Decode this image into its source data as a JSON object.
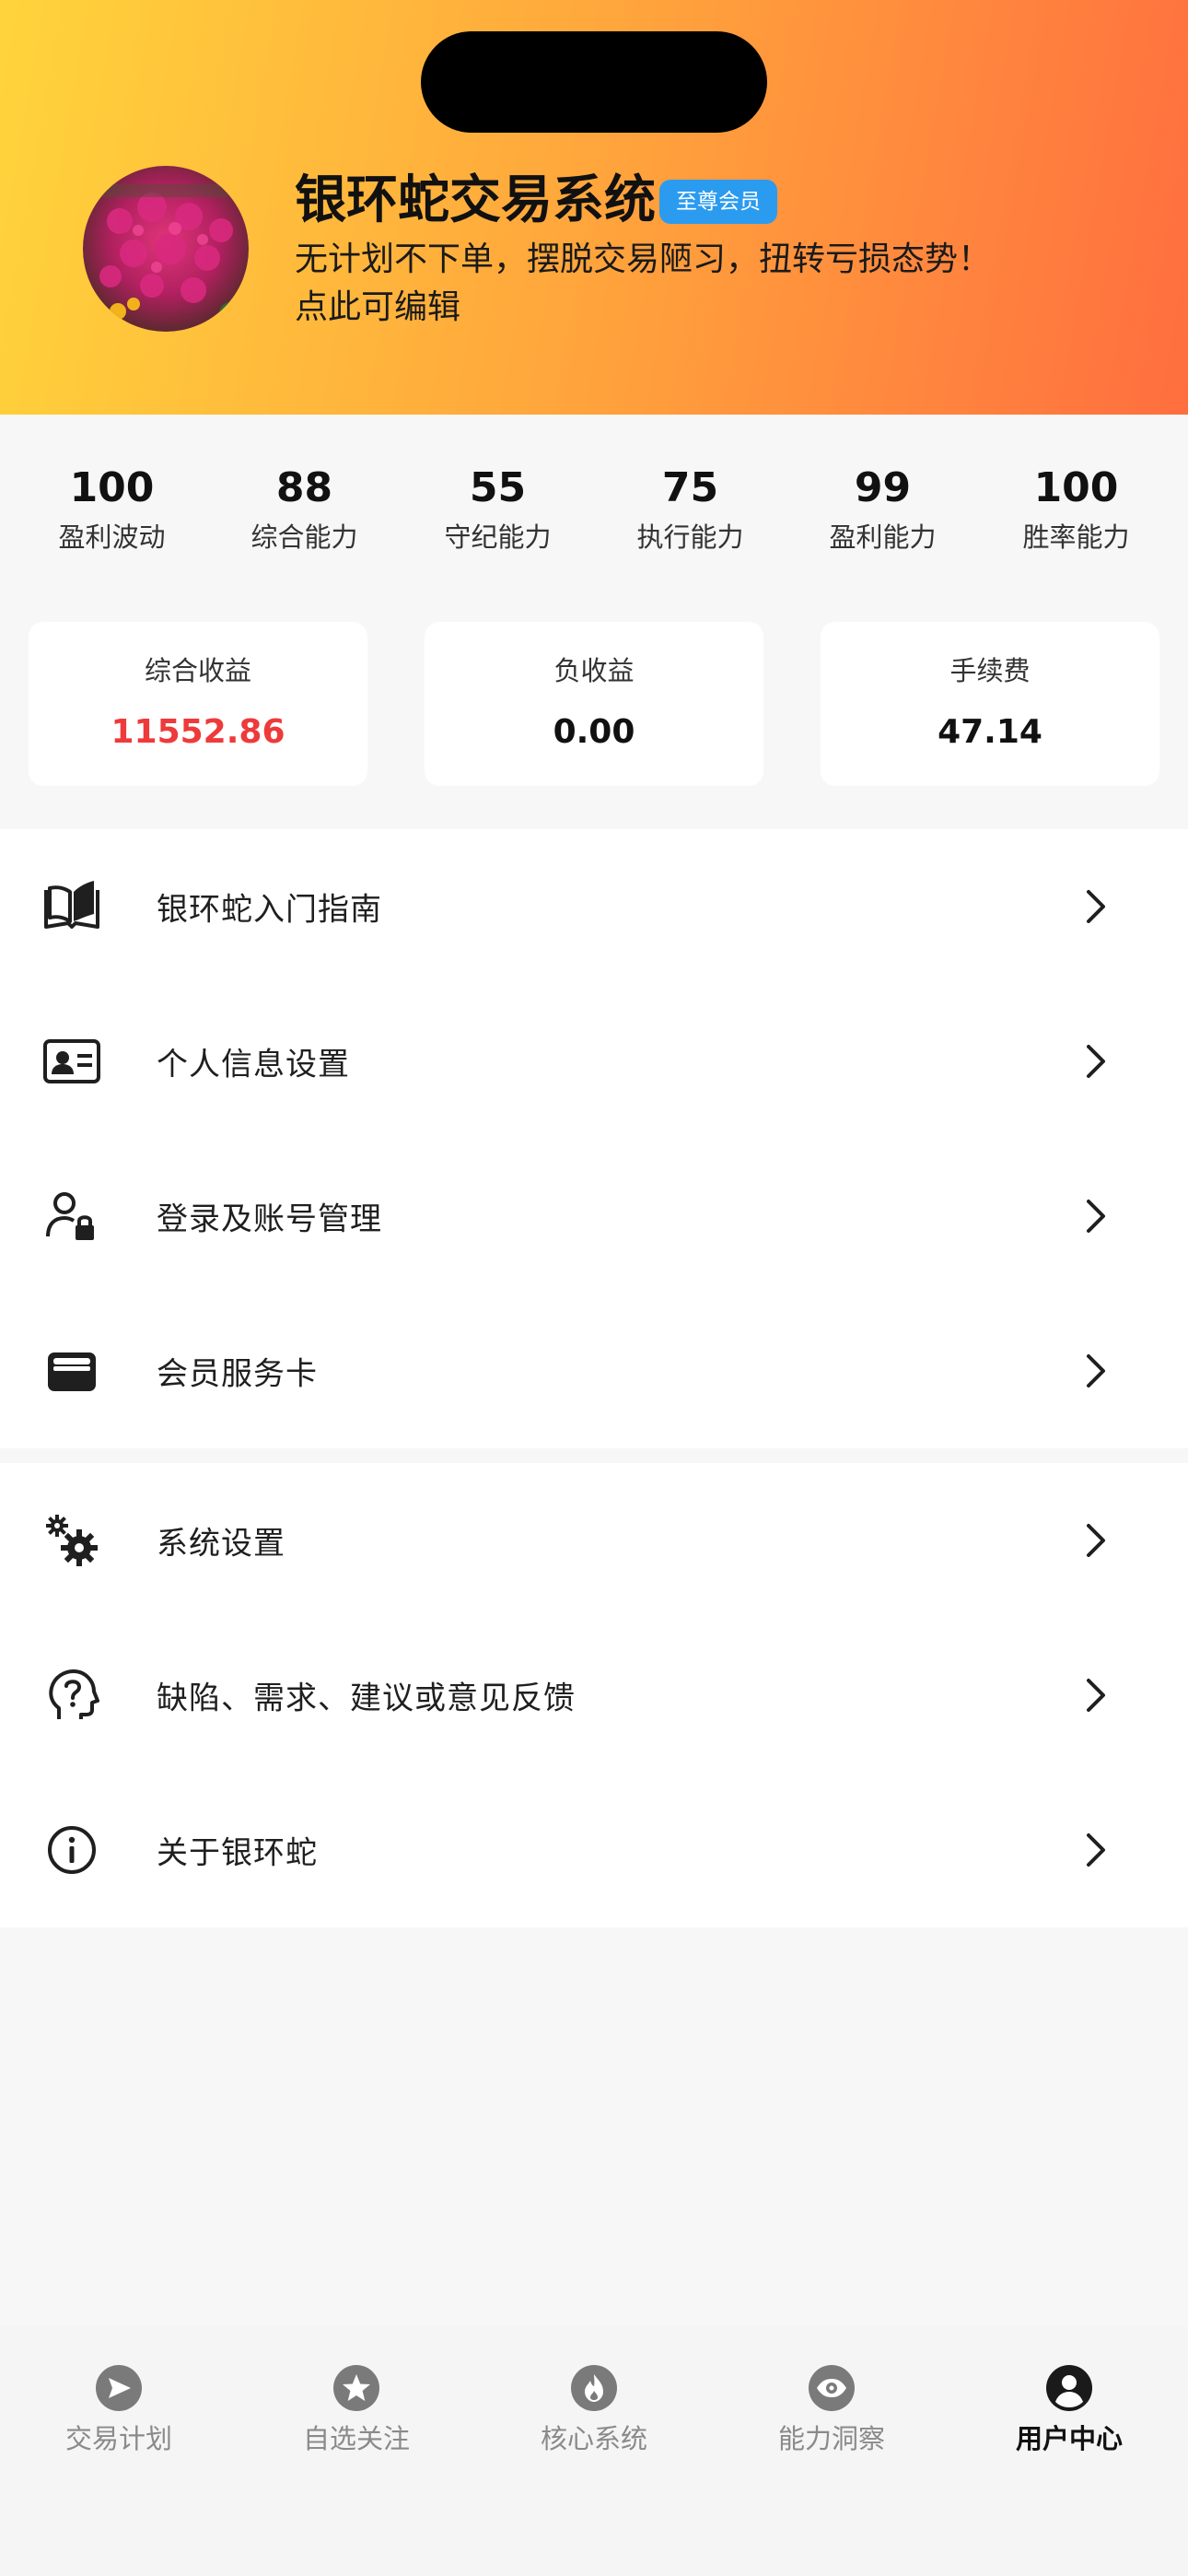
{
  "header": {
    "app_title": "银环蛇交易系统",
    "badge": "至尊会员",
    "motto_line1": "无计划不下单，摆脱交易陋习，扭转亏损态势！",
    "motto_line2": "点此可编辑"
  },
  "stats": [
    {
      "value": "100",
      "label": "盈利波动"
    },
    {
      "value": "88",
      "label": "综合能力"
    },
    {
      "value": "55",
      "label": "守纪能力"
    },
    {
      "value": "75",
      "label": "执行能力"
    },
    {
      "value": "99",
      "label": "盈利能力"
    },
    {
      "value": "100",
      "label": "胜率能力"
    }
  ],
  "cards": [
    {
      "label": "综合收益",
      "value": "11552.86"
    },
    {
      "label": "负收益",
      "value": "0.00"
    },
    {
      "label": "手续费",
      "value": "47.14"
    }
  ],
  "menu_group1": [
    {
      "label": "银环蛇入门指南",
      "icon": "book-open-icon"
    },
    {
      "label": "个人信息设置",
      "icon": "id-card-icon"
    },
    {
      "label": "登录及账号管理",
      "icon": "user-lock-icon"
    },
    {
      "label": "会员服务卡",
      "icon": "wallet-icon"
    }
  ],
  "menu_group2": [
    {
      "label": "系统设置",
      "icon": "gears-icon"
    },
    {
      "label": "缺陷、需求、建议或意见反馈",
      "icon": "head-question-icon"
    },
    {
      "label": "关于银环蛇",
      "icon": "info-circle-icon"
    }
  ],
  "tabbar": [
    {
      "label": "交易计划",
      "icon": "paper-plane-icon"
    },
    {
      "label": "自选关注",
      "icon": "star-icon"
    },
    {
      "label": "核心系统",
      "icon": "fire-icon"
    },
    {
      "label": "能力洞察",
      "icon": "eye-icon"
    },
    {
      "label": "用户中心",
      "icon": "user-circle-icon",
      "active": true
    }
  ],
  "colors": {
    "accent_red": "#ee3a3a",
    "badge_blue": "#2b9bf0",
    "header_gradient": [
      "#ffd43b",
      "#ffa53c",
      "#ff6e3f"
    ]
  }
}
